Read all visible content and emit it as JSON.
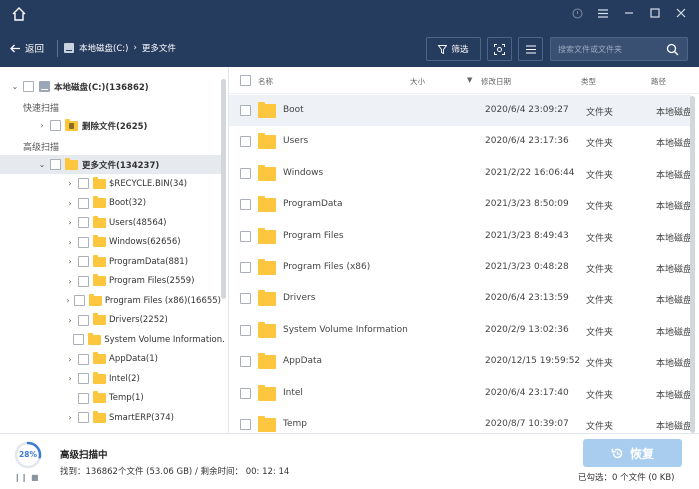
{
  "header": {
    "back_label": "返回",
    "breadcrumb": [
      "本地磁盘(C:)",
      "更多文件"
    ],
    "filter_label": "筛选",
    "search_placeholder": "搜索文件或文件夹"
  },
  "sidebar": {
    "root": {
      "label": "本地磁盘(C:)(136862)"
    },
    "quick_scan_label": "快速扫描",
    "deleted": {
      "label": "删除文件(2625)"
    },
    "advanced_scan_label": "高级扫描",
    "more": {
      "label": "更多文件(134237)"
    },
    "children": [
      "$RECYCLE.BIN(34)",
      "Boot(32)",
      "Users(48564)",
      "Windows(62656)",
      "ProgramData(881)",
      "Program Files(2559)",
      "Program Files (x86)(16655)",
      "Drivers(2252)",
      "System Volume Information.",
      "AppData(1)",
      "Intel(2)",
      "Temp(1)",
      "SmartERP(374)"
    ]
  },
  "table": {
    "headers": {
      "name": "名称",
      "size": "大小",
      "modified": "修改日期",
      "type": "类型",
      "path": "路径"
    },
    "rows": [
      {
        "name": "Boot",
        "date": "2020/6/4 23:09:27",
        "type": "文件夹",
        "path": "本地磁盘"
      },
      {
        "name": "Users",
        "date": "2020/6/4 23:17:36",
        "type": "文件夹",
        "path": "本地磁盘"
      },
      {
        "name": "Windows",
        "date": "2021/2/22 16:06:44",
        "type": "文件夹",
        "path": "本地磁盘"
      },
      {
        "name": "ProgramData",
        "date": "2021/3/23 8:50:09",
        "type": "文件夹",
        "path": "本地磁盘"
      },
      {
        "name": "Program Files",
        "date": "2021/3/23 8:49:43",
        "type": "文件夹",
        "path": "本地磁盘"
      },
      {
        "name": "Program Files (x86)",
        "date": "2021/3/23 0:48:28",
        "type": "文件夹",
        "path": "本地磁盘"
      },
      {
        "name": "Drivers",
        "date": "2020/6/4 23:13:59",
        "type": "文件夹",
        "path": "本地磁盘"
      },
      {
        "name": "System Volume Information",
        "date": "2020/2/9 13:02:36",
        "type": "文件夹",
        "path": "本地磁盘"
      },
      {
        "name": "AppData",
        "date": "2020/12/15 19:59:52",
        "type": "文件夹",
        "path": "本地磁盘"
      },
      {
        "name": "Intel",
        "date": "2020/6/4 23:17:40",
        "type": "文件夹",
        "path": "本地磁盘"
      },
      {
        "name": "Temp",
        "date": "2020/8/7 10:39:07",
        "type": "文件夹",
        "path": "本地磁盘"
      }
    ]
  },
  "status": {
    "progress_text": "28%",
    "progress": 0.28,
    "title": "高级扫描中",
    "found_line": "找到：136862个文件 (53.06 GB) / 剩余时间： 00: 12: 14",
    "recover_label": "恢复",
    "selected_line": "已勾选：0 个文件 (0 KB)"
  },
  "colors": {
    "header_bg": "#263c5f",
    "accent": "#3a7bd5",
    "folder": "#fcc73f",
    "recover_disabled": "#a9cdef"
  }
}
